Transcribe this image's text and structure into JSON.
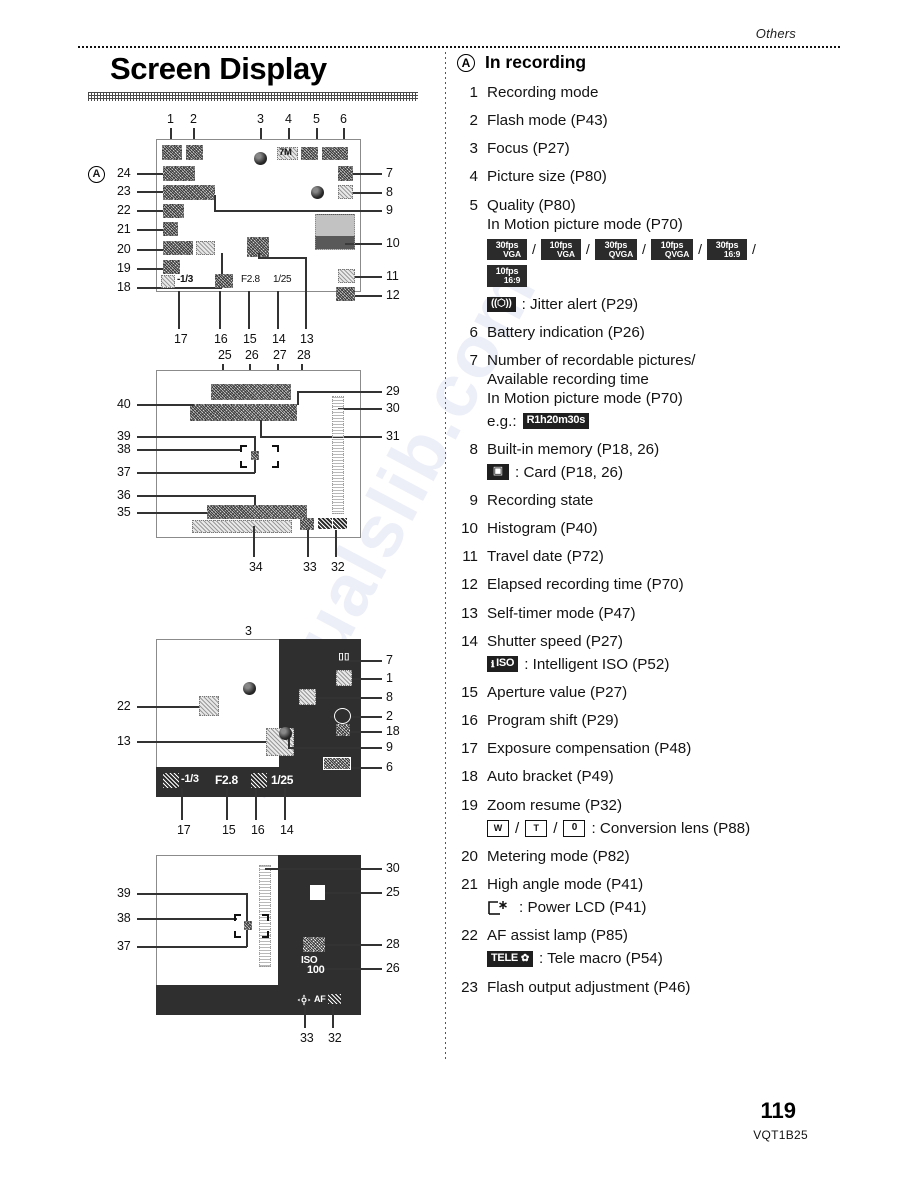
{
  "header": {
    "section_label": "Others"
  },
  "page": {
    "title": "Screen Display",
    "number": "119",
    "doc_code": "VQT1B25",
    "watermark": "manualslib.com"
  },
  "recording_section": {
    "marker": "A",
    "heading": "In recording"
  },
  "diagrams": [
    {
      "id": "diagram-1",
      "marker": "A",
      "top_callouts": [
        "1",
        "2",
        "3",
        "4",
        "5",
        "6"
      ],
      "left_callouts": [
        "24",
        "23",
        "22",
        "21",
        "20",
        "19",
        "18"
      ],
      "right_callouts": [
        "7",
        "8",
        "9",
        "10",
        "11",
        "12"
      ],
      "bottom_callouts": [
        "17",
        "16",
        "15",
        "14",
        "13"
      ],
      "osd_values": {
        "picture_size": "7M",
        "exposure_compensation": "-1/3",
        "aperture": "F2.8",
        "shutter_speed": "1/25"
      }
    },
    {
      "id": "diagram-2",
      "top_callouts": [
        "25",
        "26",
        "27",
        "28"
      ],
      "left_callouts": [
        "40",
        "39",
        "38",
        "37",
        "36",
        "35"
      ],
      "right_callouts": [
        "29",
        "30",
        "31"
      ],
      "bottom_callouts": [
        "34",
        "33",
        "32"
      ]
    },
    {
      "id": "diagram-3",
      "top_callouts": [
        "3"
      ],
      "left_callouts": [
        "22",
        "13"
      ],
      "right_callouts": [
        "7",
        "1",
        "8",
        "2",
        "18",
        "9",
        "6"
      ],
      "bottom_callouts": [
        "17",
        "15",
        "16",
        "14"
      ],
      "osd_values": {
        "exposure_compensation": "-1/3",
        "aperture": "F2.8",
        "shutter_speed": "1/25"
      }
    },
    {
      "id": "diagram-4",
      "left_callouts": [
        "39",
        "38",
        "37"
      ],
      "right_callouts": [
        "30",
        "25",
        "28",
        "26"
      ],
      "bottom_callouts": [
        "33",
        "32"
      ],
      "osd_values": {
        "iso_label": "ISO",
        "iso_value": "100",
        "af_label": "AF"
      }
    }
  ],
  "legend": [
    {
      "index": "1",
      "label": "Recording mode"
    },
    {
      "index": "2",
      "label": "Flash mode (P43)"
    },
    {
      "index": "3",
      "label": "Focus (P27)"
    },
    {
      "index": "4",
      "label": "Picture size (P80)"
    },
    {
      "index": "5",
      "label": "Quality (P80)",
      "sub": "In Motion picture mode (P70)",
      "chips": [
        {
          "fps": "30fps",
          "res": "VGA"
        },
        {
          "fps": "10fps",
          "res": "VGA"
        },
        {
          "fps": "30fps",
          "res": "QVGA"
        },
        {
          "fps": "10fps",
          "res": "QVGA"
        },
        {
          "fps": "30fps",
          "res": "16:9"
        },
        {
          "fps": "10fps",
          "res": "16:9"
        }
      ],
      "note_icon": "jitter-alert-icon",
      "note": ": Jitter alert (P29)"
    },
    {
      "index": "6",
      "label": "Battery indication (P26)"
    },
    {
      "index": "7",
      "label": "Number of recordable pictures/",
      "line2": "Available recording time",
      "line3": "In Motion picture mode (P70)",
      "example_prefix": "e.g.:",
      "example_value": "R1h20m30s"
    },
    {
      "index": "8",
      "label": "Built-in memory (P18, 26)",
      "note_icon": "card-icon",
      "note": ": Card (P18, 26)"
    },
    {
      "index": "9",
      "label": "Recording state"
    },
    {
      "index": "10",
      "label": "Histogram (P40)"
    },
    {
      "index": "11",
      "label": "Travel date (P72)"
    },
    {
      "index": "12",
      "label": "Elapsed recording time (P70)"
    },
    {
      "index": "13",
      "label": "Self-timer mode (P47)"
    },
    {
      "index": "14",
      "label": "Shutter speed (P27)",
      "note_icon": "intelligent-iso-icon",
      "note_icon_text": "ISO",
      "note": ": Intelligent ISO (P52)"
    },
    {
      "index": "15",
      "label": "Aperture value (P27)"
    },
    {
      "index": "16",
      "label": "Program shift (P29)"
    },
    {
      "index": "17",
      "label": "Exposure compensation (P48)"
    },
    {
      "index": "18",
      "label": "Auto bracket (P49)"
    },
    {
      "index": "19",
      "label": "Zoom resume (P32)",
      "conversion_icons": [
        "W",
        "T",
        "0"
      ],
      "note": ": Conversion lens (P88)"
    },
    {
      "index": "20",
      "label": "Metering mode (P82)"
    },
    {
      "index": "21",
      "label": "High angle mode (P41)",
      "note_icon": "power-lcd-icon",
      "note": ": Power LCD (P41)"
    },
    {
      "index": "22",
      "label": "AF assist lamp (P85)",
      "note_icon": "tele-macro-icon",
      "note_icon_text": "TELE",
      "note": ": Tele macro (P54)"
    },
    {
      "index": "23",
      "label": "Flash output adjustment (P46)"
    }
  ]
}
